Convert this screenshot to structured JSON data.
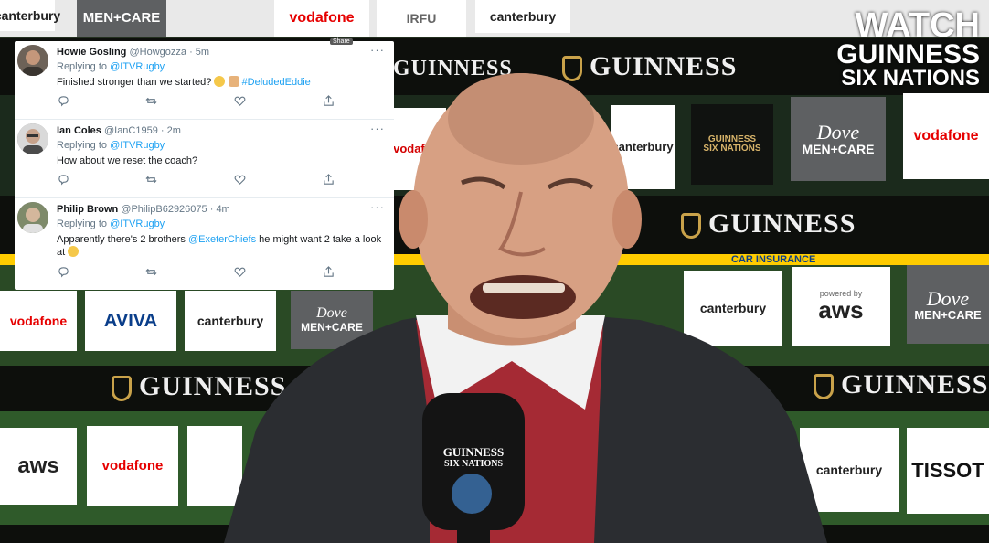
{
  "video": {
    "watermark": {
      "line1": "WATCH",
      "line2": "GUINNESS",
      "line3": "SIX NATIONS"
    },
    "boards": {
      "guinness": "GUINNESS",
      "vodafone": "vodafone",
      "canterbury": "canterbury",
      "dove": "Dove",
      "dove_sub": "MEN+CARE",
      "aws": "aws",
      "aws_powered": "powered by",
      "aviva": "AVIVA",
      "tissot": "TISSOT",
      "six_nations": "SIX NATIONS",
      "irfu": "IRFU",
      "car_insurance": "CAR INSURANCE"
    },
    "microphone_label": "GUINNESS",
    "microphone_sub": "SIX NATIONS"
  },
  "tweets_panel": {
    "share_tooltip": "Share",
    "tweets": [
      {
        "name": "Howie Gosling",
        "handle": "@Howgozza",
        "time": "· 5m",
        "replying_prefix": "Replying to",
        "replying_to": "@ITVRugby",
        "text_before": "Finished stronger than we started? ",
        "hashtag": "#DeludedEddie",
        "more": "···"
      },
      {
        "name": "Ian Coles",
        "handle": "@IanC1959",
        "time": "· 2m",
        "replying_prefix": "Replying to",
        "replying_to": "@ITVRugby",
        "text_before": "How about we reset the coach?",
        "more": "···"
      },
      {
        "name": "Philip Brown",
        "handle": "@PhilipB62926075",
        "time": "· 4m",
        "replying_prefix": "Replying to",
        "replying_to": "@ITVRugby",
        "text_before": "Apparently there's 2 brothers ",
        "mention": "@ExeterChiefs",
        "text_after": " he might want 2 take a look at ",
        "more": "···"
      }
    ]
  },
  "colors": {
    "link": "#1da1f2",
    "vodafone_red": "#e60000",
    "guinness_gold": "#c9a24a"
  }
}
